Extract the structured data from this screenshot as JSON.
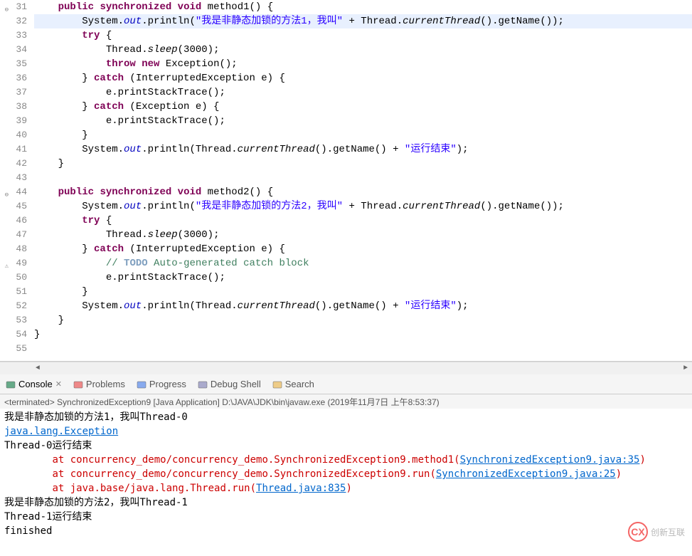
{
  "editor": {
    "highlighted_line": 32,
    "lines": [
      {
        "n": 31,
        "marker": "⊖",
        "html": "    <span class='kw'>public</span> <span class='kw'>synchronized</span> <span class='kw'>void</span> method1() {"
      },
      {
        "n": 32,
        "marker": "",
        "html": "        System.<span class='field'>out</span>.println(<span class='str'>\"我是非静态加锁的方法1，我叫\"</span> + Thread.<span class='method-static'>currentThread</span>().getName());",
        "hl": true
      },
      {
        "n": 33,
        "marker": "",
        "html": "        <span class='kw'>try</span> {"
      },
      {
        "n": 34,
        "marker": "",
        "html": "            Thread.<span class='method-static'>sleep</span>(3000);"
      },
      {
        "n": 35,
        "marker": "",
        "html": "            <span class='kw'>throw</span> <span class='kw'>new</span> Exception();"
      },
      {
        "n": 36,
        "marker": "",
        "html": "        } <span class='kw'>catch</span> (InterruptedException e) {"
      },
      {
        "n": 37,
        "marker": "",
        "html": "            e.printStackTrace();"
      },
      {
        "n": 38,
        "marker": "",
        "html": "        } <span class='kw'>catch</span> (Exception e) {"
      },
      {
        "n": 39,
        "marker": "",
        "html": "            e.printStackTrace();"
      },
      {
        "n": 40,
        "marker": "",
        "html": "        }"
      },
      {
        "n": 41,
        "marker": "",
        "html": "        System.<span class='field'>out</span>.println(Thread.<span class='method-static'>currentThread</span>().getName() + <span class='str'>\"运行结束\"</span>);"
      },
      {
        "n": 42,
        "marker": "",
        "html": "    }"
      },
      {
        "n": 43,
        "marker": "",
        "html": ""
      },
      {
        "n": 44,
        "marker": "⊖",
        "html": "    <span class='kw'>public</span> <span class='kw'>synchronized</span> <span class='kw'>void</span> method2() {"
      },
      {
        "n": 45,
        "marker": "",
        "html": "        System.<span class='field'>out</span>.println(<span class='str'>\"我是非静态加锁的方法2，我叫\"</span> + Thread.<span class='method-static'>currentThread</span>().getName());"
      },
      {
        "n": 46,
        "marker": "",
        "html": "        <span class='kw'>try</span> {"
      },
      {
        "n": 47,
        "marker": "",
        "html": "            Thread.<span class='method-static'>sleep</span>(3000);"
      },
      {
        "n": 48,
        "marker": "",
        "html": "        } <span class='kw'>catch</span> (InterruptedException e) {"
      },
      {
        "n": 49,
        "marker": "⚠",
        "html": "            <span class='comment'>// <span class='todo'>TODO</span> Auto-generated catch block</span>"
      },
      {
        "n": 50,
        "marker": "",
        "html": "            e.printStackTrace();"
      },
      {
        "n": 51,
        "marker": "",
        "html": "        }"
      },
      {
        "n": 52,
        "marker": "",
        "html": "        System.<span class='field'>out</span>.println(Thread.<span class='method-static'>currentThread</span>().getName() + <span class='str'>\"运行结束\"</span>);"
      },
      {
        "n": 53,
        "marker": "",
        "html": "    }"
      },
      {
        "n": 54,
        "marker": "",
        "html": "}"
      },
      {
        "n": 55,
        "marker": "",
        "html": ""
      }
    ]
  },
  "tabs": {
    "items": [
      {
        "label": "Console",
        "icon": "console-icon",
        "active": true,
        "closable": true
      },
      {
        "label": "Problems",
        "icon": "problems-icon",
        "active": false
      },
      {
        "label": "Progress",
        "icon": "progress-icon",
        "active": false
      },
      {
        "label": "Debug Shell",
        "icon": "debug-shell-icon",
        "active": false
      },
      {
        "label": "Search",
        "icon": "search-icon",
        "active": false
      }
    ]
  },
  "console": {
    "header": "<terminated> SynchronizedException9 [Java Application] D:\\JAVA\\JDK\\bin\\javaw.exe (2019年11月7日 上午8:53:37)",
    "lines": [
      {
        "text": "我是非静态加锁的方法1，我叫Thread-0",
        "cls": ""
      },
      {
        "text": "java.lang.Exception",
        "cls": "err link"
      },
      {
        "text": "Thread-0运行结束",
        "cls": ""
      },
      {
        "segments": [
          {
            "t": "\tat concurrency_demo/concurrency_demo.SynchronizedException9.method1(",
            "cls": "err"
          },
          {
            "t": "SynchronizedException9.java:35",
            "cls": "err link"
          },
          {
            "t": ")",
            "cls": "err"
          }
        ]
      },
      {
        "segments": [
          {
            "t": "\tat concurrency_demo/concurrency_demo.SynchronizedException9.run(",
            "cls": "err"
          },
          {
            "t": "SynchronizedException9.java:25",
            "cls": "err link"
          },
          {
            "t": ")",
            "cls": "err"
          }
        ]
      },
      {
        "segments": [
          {
            "t": "\tat java.base/java.lang.Thread.run(",
            "cls": "err"
          },
          {
            "t": "Thread.java:835",
            "cls": "err link"
          },
          {
            "t": ")",
            "cls": "err"
          }
        ]
      },
      {
        "text": "我是非静态加锁的方法2，我叫Thread-1",
        "cls": ""
      },
      {
        "text": "Thread-1运行结束",
        "cls": ""
      },
      {
        "text": "finished",
        "cls": ""
      }
    ]
  },
  "watermark": {
    "text": "创新互联"
  }
}
